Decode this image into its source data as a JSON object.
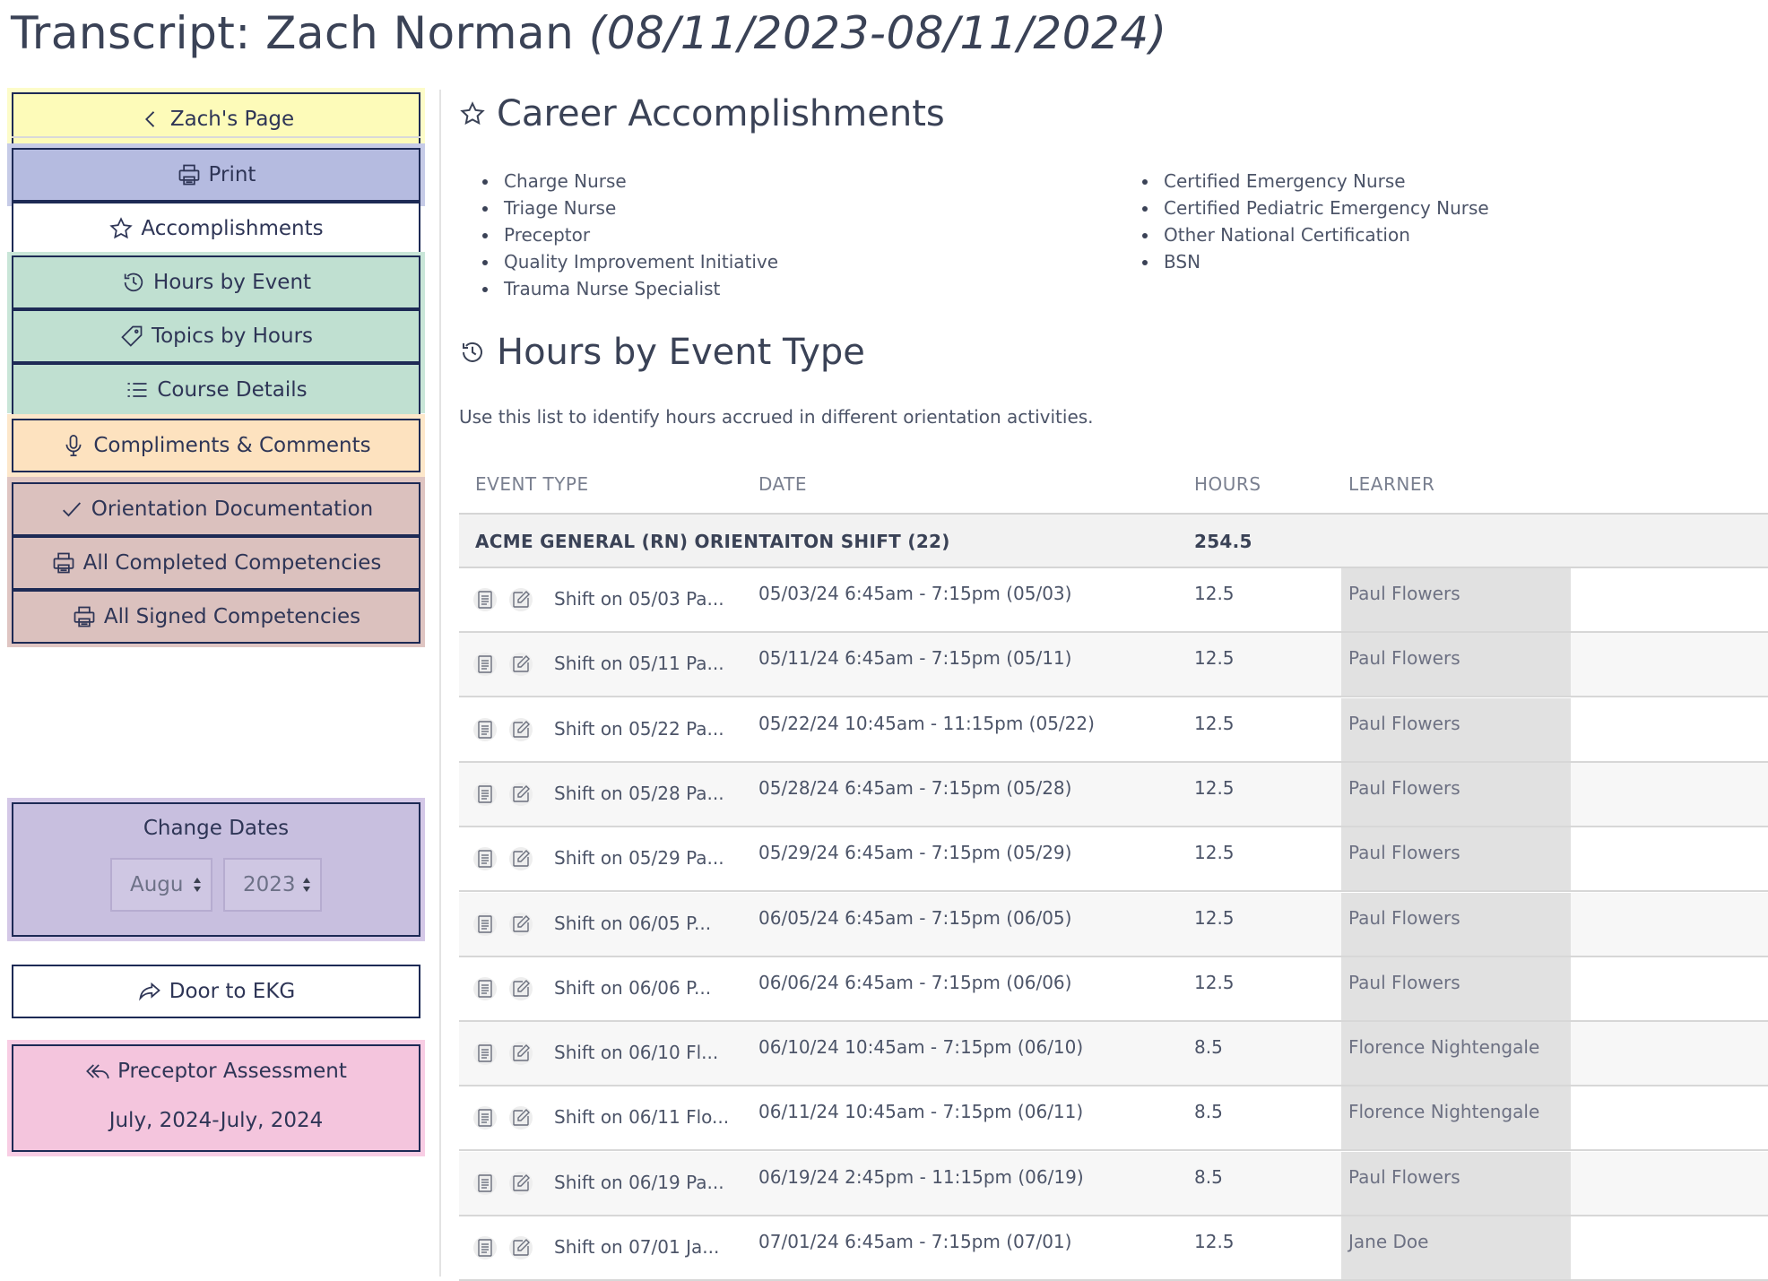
{
  "page": {
    "title_name": "Transcript: Zach Norman",
    "title_range": "(08/11/2023-08/11/2024)"
  },
  "sidebar": {
    "back_label": "Zach's Page",
    "print_label": "Print",
    "accomplishments_label": "Accomplishments",
    "hours_by_event_label": "Hours by Event",
    "topics_by_hours_label": "Topics by Hours",
    "course_details_label": "Course Details",
    "compliments_label": "Compliments & Comments",
    "orientation_doc_label": "Orientation Documentation",
    "all_completed_label": "All Completed Competencies",
    "all_signed_label": "All Signed Competencies",
    "change_dates": {
      "title": "Change Dates",
      "month_value": "Augu",
      "year_value": "2023"
    },
    "door_to_ekg_label": "Door to EKG",
    "preceptor": {
      "title": "Preceptor Assessment",
      "subtitle": "July, 2024-July, 2024"
    }
  },
  "accomplishments": {
    "heading": "Career Accomplishments",
    "left": [
      "Charge Nurse",
      "Triage Nurse",
      "Preceptor",
      "Quality Improvement Initiative",
      "Trauma Nurse Specialist"
    ],
    "right": [
      "Certified Emergency Nurse",
      "Certified Pediatric Emergency Nurse",
      "Other National Certification",
      "BSN"
    ]
  },
  "hours": {
    "heading": "Hours by Event Type",
    "intro": "Use this list to identify hours accrued in different orientation activities.",
    "columns": [
      "EVENT TYPE",
      "DATE",
      "HOURS",
      "LEARNER"
    ],
    "group": {
      "label": "ACME GENERAL (RN) ORIENTAITON SHIFT (22)",
      "hours": "254.5"
    },
    "rows": [
      {
        "event": "Shift on 05/03 Pa...",
        "date": "05/03/24 6:45am - 7:15pm (05/03)",
        "hours": "12.5",
        "learner": "Paul Flowers"
      },
      {
        "event": "Shift on 05/11 Pa...",
        "date": "05/11/24 6:45am - 7:15pm (05/11)",
        "hours": "12.5",
        "learner": "Paul Flowers"
      },
      {
        "event": "Shift on 05/22 Pa...",
        "date": "05/22/24 10:45am - 11:15pm (05/22)",
        "hours": "12.5",
        "learner": "Paul Flowers"
      },
      {
        "event": "Shift on 05/28 Pa...",
        "date": "05/28/24 6:45am - 7:15pm (05/28)",
        "hours": "12.5",
        "learner": "Paul Flowers"
      },
      {
        "event": "Shift on 05/29 Pa...",
        "date": "05/29/24 6:45am - 7:15pm (05/29)",
        "hours": "12.5",
        "learner": "Paul Flowers"
      },
      {
        "event": "Shift on 06/05 P...",
        "date": "06/05/24 6:45am - 7:15pm (06/05)",
        "hours": "12.5",
        "learner": "Paul Flowers"
      },
      {
        "event": "Shift on 06/06 P...",
        "date": "06/06/24 6:45am - 7:15pm (06/06)",
        "hours": "12.5",
        "learner": "Paul Flowers"
      },
      {
        "event": "Shift on 06/10 Fl...",
        "date": "06/10/24 10:45am - 7:15pm (06/10)",
        "hours": "8.5",
        "learner": "Florence Nightengale"
      },
      {
        "event": "Shift on 06/11 Flo...",
        "date": "06/11/24 10:45am - 7:15pm (06/11)",
        "hours": "8.5",
        "learner": "Florence Nightengale"
      },
      {
        "event": "Shift on 06/19 Pa...",
        "date": "06/19/24 2:45pm - 11:15pm (06/19)",
        "hours": "8.5",
        "learner": "Paul Flowers"
      },
      {
        "event": "Shift on 07/01 Ja...",
        "date": "07/01/24 6:45am - 7:15pm (07/01)",
        "hours": "12.5",
        "learner": "Jane Doe"
      }
    ]
  }
}
